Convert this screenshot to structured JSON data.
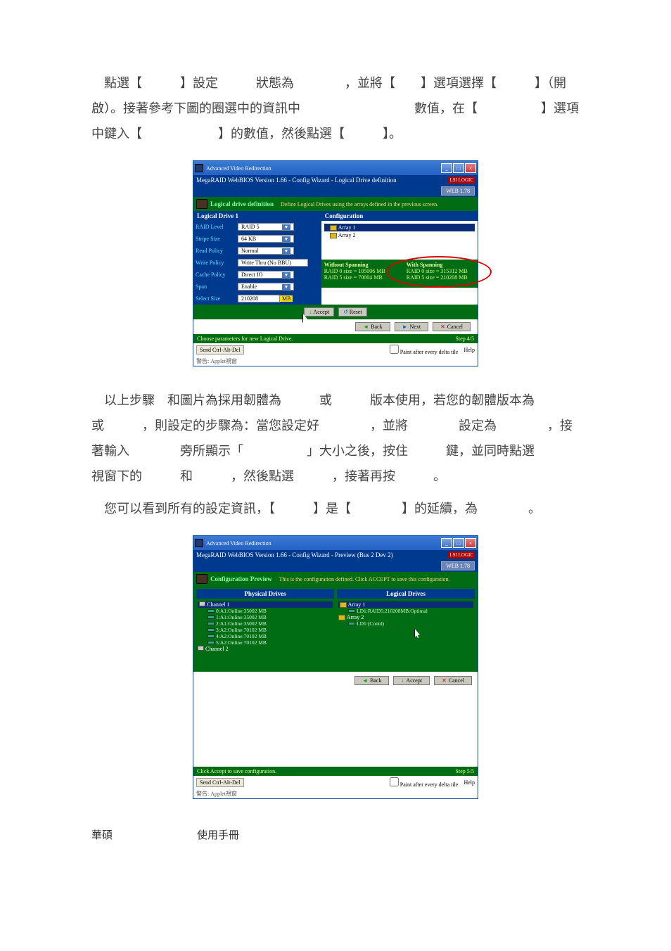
{
  "para1_text": "點選【　　　】設定　　　狀態為　　　　，並將【　　】選項選擇【　　　】（開啟）。接著參考下圖的圈選中的資訊中　　　　　　　　　數值，在【　　　　　】選項中鍵入【　　　　　　】的數值，然後點選【　　　】。",
  "para2_text": "以上步驟　和圖片為採用韌體為　　　或　　　版本使用，若您的韌體版本為　　　或　　　，則設定的步驟為：當您設定好　　　　，並將　　　　設定為　　　　，接著輸入　　　　旁所顯示「　　　　　」大小之後，按住　　　鍵，並同時點選　　　　　視窗下的　　　和　　　，然後點選　　　，接著再按　　　。",
  "para3_text": "您可以看到所有的設定資訊，【　　　】是【　　　　】的延續，為　　　　。",
  "footer_text": "華碩　　　　　　　　使用手冊",
  "win1": {
    "title": "Advanced Video Redirection",
    "headerbar": "MegaRAID WebBIOS Version 1.66 - Config Wizard - Logical Drive definition",
    "brand": "LSI LOGIC",
    "webbtn": "WEB 1.78",
    "subhead_title": "Logical drive definition",
    "subhead_desc": "Define Logical Drives using the arrays defined in the previous screen.",
    "left_title": "Logical Drive 1",
    "right_title": "Configuration",
    "fields": {
      "raid_level": {
        "label": "RAID Level",
        "value": "RAID 5"
      },
      "stripe_size": {
        "label": "Stripe Size",
        "value": "64 KB"
      },
      "read_policy": {
        "label": "Read Policy",
        "value": "Normal"
      },
      "write_policy": {
        "label": "Write Policy",
        "value": "Write Thru (No BBU)"
      },
      "cache_policy": {
        "label": "Cache Policy",
        "value": "Direct IO"
      },
      "span": {
        "label": "Span",
        "value": "Enable"
      },
      "select_size": {
        "label": "Select Size",
        "value": "210208",
        "unit": "MB"
      }
    },
    "tree": {
      "array1": "Array 1",
      "array2": "Array 2"
    },
    "span_panel": {
      "without_title": "Without Spanning",
      "without_l1": "RAID 0 size = 105006 MB",
      "without_l2": "RAID 5 size = 70004 MB",
      "with_title": "With Spanning",
      "with_l1": "RAID 0 size = 315312 MB",
      "with_l2": "RAID 5 size = 210208 MB"
    },
    "btn_accept": "Accept",
    "btn_reset": "Reset",
    "btn_back": "Back",
    "btn_next": "Next",
    "btn_cancel": "Cancel",
    "footer_left": "Choose parameters for new Logical Drive.",
    "footer_right": "Step 4/5",
    "send_btn": "Send Ctrl-Alt-Del",
    "paint_check": "Paint after every delta tile",
    "help": "Help",
    "substatus": "警告: Applet視窗"
  },
  "win2": {
    "title": "Advanced Video Redirection",
    "headerbar": "MegaRAID WebBIOS Version 1.66 - Config Wizard - Preview (Bus 2 Dev 2)",
    "brand": "LSI LOGIC",
    "webbtn": "WEB 1.78",
    "subhead_title": "Configuration Preview",
    "subhead_desc": "This is the configuration defined. Click ACCEPT to save this configuration.",
    "phys_title": "Physical Drives",
    "log_title": "Logical Drives",
    "channel1": "Channel 1",
    "drives": [
      "0:A1:Online:35002 MB",
      "1:A1:Online:35002 MB",
      "2:A1:Online:35002 MB",
      "3:A2:Online:70102 MB",
      "4:A2:Online:70102 MB",
      "5:A2:Online:70102 MB"
    ],
    "channel2": "Channel 2",
    "ld_array1": "Array 1",
    "ld_entry1": "LD1:RAID5:210208MB:Optimal",
    "ld_array2": "Array 2",
    "ld_entry2": "LD1:(Contd)",
    "btn_back": "Back",
    "btn_accept": "Accept",
    "btn_cancel": "Cancel",
    "footer_left": "Click Accept to save configuration.",
    "footer_right": "Step 5/5",
    "send_btn": "Send Ctrl-Alt-Del",
    "paint_check": "Paint after every delta tile",
    "help": "Help",
    "substatus": "警告: Applet視窗"
  }
}
